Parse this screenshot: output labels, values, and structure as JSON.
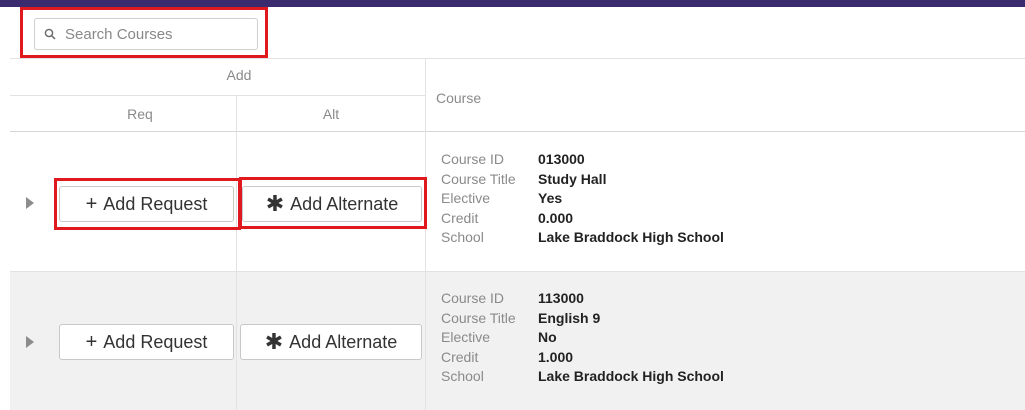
{
  "search": {
    "placeholder": "Search Courses",
    "value": ""
  },
  "table": {
    "group_header": "Add",
    "col_req": "Req",
    "col_alt": "Alt",
    "col_course": "Course"
  },
  "rows": [
    {
      "add_request_label": "Add Request",
      "add_alternate_label": "Add Alternate",
      "course_id_label": "Course ID",
      "course_id": "013000",
      "course_title_label": "Course Title",
      "course_title": "Study Hall",
      "elective_label": "Elective",
      "elective": "Yes",
      "credit_label": "Credit",
      "credit": "0.000",
      "school_label": "School",
      "school": "Lake Braddock High School"
    },
    {
      "add_request_label": "Add Request",
      "add_alternate_label": "Add Alternate",
      "course_id_label": "Course ID",
      "course_id": "113000",
      "course_title_label": "Course Title",
      "course_title": "English 9",
      "elective_label": "Elective",
      "elective": "No",
      "credit_label": "Credit",
      "credit": "1.000",
      "school_label": "School",
      "school": "Lake Braddock High School"
    }
  ],
  "icons": {
    "search": "search-icon",
    "expand": "expand-triangle-icon",
    "add": "plus-icon",
    "alternate": "asterisk-icon"
  },
  "colors": {
    "header_bar": "#3a2a6e",
    "highlight": "#e0191f",
    "alt_row": "#f1f1f1"
  }
}
